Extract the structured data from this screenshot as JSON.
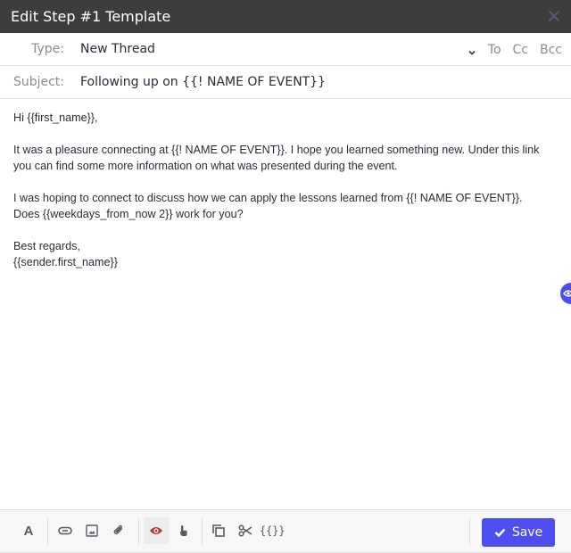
{
  "window": {
    "title": "Edit Step #1 Template",
    "close_icon": "close-icon"
  },
  "fields": {
    "type": {
      "label": "Type:",
      "value": "New Thread"
    },
    "subject": {
      "label": "Subject:",
      "value": "Following up on {{! NAME OF EVENT}}"
    },
    "recipients": [
      "To",
      "Cc",
      "Bcc"
    ]
  },
  "body": {
    "lines": [
      "Hi {{first_name}},",
      "",
      "It was a pleasure connecting at {{! NAME OF EVENT}}. I hope you learned something new. Under this link",
      "you can find some more information on what was presented during the event.",
      "",
      "I was hoping to connect to discuss how we can apply the lessons learned from {{! NAME OF EVENT}}.",
      "Does {{weekdays_from_now 2}} work for you?",
      "",
      "Best regards,",
      "{{sender.first_name}}"
    ]
  },
  "toolbar": {
    "items": [
      {
        "name": "text-format",
        "icon": "font-icon"
      },
      {
        "name": "link",
        "icon": "link-icon"
      },
      {
        "name": "image",
        "icon": "image-icon"
      },
      {
        "name": "attachment",
        "icon": "paperclip-icon"
      },
      {
        "name": "preview",
        "icon": "eye-icon",
        "active": true
      },
      {
        "name": "touch",
        "icon": "pointer-hand-icon"
      },
      {
        "name": "copy",
        "icon": "copy-icon"
      },
      {
        "name": "snippet",
        "icon": "scissors-icon"
      },
      {
        "name": "variables",
        "icon": "braces-icon"
      }
    ],
    "text_label": "A",
    "variables_label": "{{}}",
    "save_label": "Save"
  },
  "colors": {
    "accent": "#4e4ef0",
    "titlebar": "#3d3d3d",
    "preview_active": "#b03a2e"
  }
}
